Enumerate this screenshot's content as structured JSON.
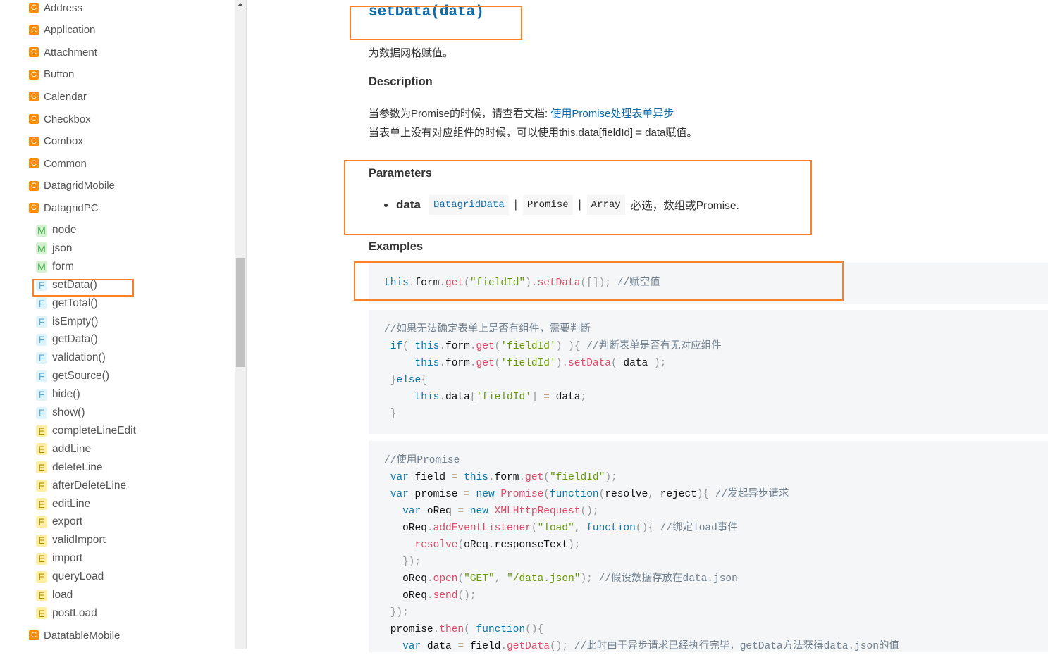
{
  "sidebar": {
    "classes": [
      {
        "icon": "C",
        "label": "Address"
      },
      {
        "icon": "C",
        "label": "Application"
      },
      {
        "icon": "C",
        "label": "Attachment"
      },
      {
        "icon": "C",
        "label": "Button"
      },
      {
        "icon": "C",
        "label": "Calendar"
      },
      {
        "icon": "C",
        "label": "Checkbox"
      },
      {
        "icon": "C",
        "label": "Combox"
      },
      {
        "icon": "C",
        "label": "Common"
      },
      {
        "icon": "C",
        "label": "DatagridMobile"
      },
      {
        "icon": "C",
        "label": "DatagridPC"
      }
    ],
    "members": [
      {
        "icon": "M",
        "label": "node"
      },
      {
        "icon": "M",
        "label": "json"
      },
      {
        "icon": "M",
        "label": "form"
      },
      {
        "icon": "F",
        "label": "setData()"
      },
      {
        "icon": "F",
        "label": "getTotal()"
      },
      {
        "icon": "F",
        "label": "isEmpty()"
      },
      {
        "icon": "F",
        "label": "getData()"
      },
      {
        "icon": "F",
        "label": "validation()"
      },
      {
        "icon": "F",
        "label": "getSource()"
      },
      {
        "icon": "F",
        "label": "hide()"
      },
      {
        "icon": "F",
        "label": "show()"
      },
      {
        "icon": "E",
        "label": "completeLineEdit"
      },
      {
        "icon": "E",
        "label": "addLine"
      },
      {
        "icon": "E",
        "label": "deleteLine"
      },
      {
        "icon": "E",
        "label": "afterDeleteLine"
      },
      {
        "icon": "E",
        "label": "editLine"
      },
      {
        "icon": "E",
        "label": "export"
      },
      {
        "icon": "E",
        "label": "validImport"
      },
      {
        "icon": "E",
        "label": "import"
      },
      {
        "icon": "E",
        "label": "queryLoad"
      },
      {
        "icon": "E",
        "label": "load"
      },
      {
        "icon": "E",
        "label": "postLoad"
      }
    ],
    "after": [
      {
        "icon": "C",
        "label": "DatatableMobile"
      }
    ]
  },
  "main": {
    "title": "setData(data)",
    "summary": "为数据网格赋值。",
    "description_heading": "Description",
    "desc1_prefix": "当参数为Promise的时候，请查看文档: ",
    "desc1_link": "使用Promise处理表单异步",
    "desc2": "当表单上没有对应组件的时候，可以使用this.data[fieldId] = data赋值。",
    "parameters_heading": "Parameters",
    "param": {
      "name": "data",
      "types": [
        "DatagridData",
        "Promise",
        "Array"
      ],
      "separator": "|",
      "desc": "必选，数组或Promise."
    },
    "examples_heading": "Examples"
  },
  "code": [
    [
      [
        [
          "k",
          "this"
        ],
        [
          "p",
          "."
        ],
        [
          "t",
          "form"
        ],
        [
          "p",
          "."
        ],
        [
          "f",
          "get"
        ],
        [
          "p",
          "("
        ],
        [
          "s",
          "\"fieldId\""
        ],
        [
          "p",
          ")"
        ],
        [
          "p",
          "."
        ],
        [
          "f",
          "setData"
        ],
        [
          "p",
          "([]);"
        ],
        [
          "t",
          " "
        ],
        [
          "c",
          "//赋空值"
        ]
      ]
    ],
    [
      [
        [
          "c",
          "//如果无法确定表单上是否有组件，需要判断"
        ]
      ],
      [
        [
          "t",
          " "
        ],
        [
          "k",
          "if"
        ],
        [
          "p",
          "("
        ],
        [
          "t",
          " "
        ],
        [
          "k",
          "this"
        ],
        [
          "p",
          "."
        ],
        [
          "t",
          "form"
        ],
        [
          "p",
          "."
        ],
        [
          "f",
          "get"
        ],
        [
          "p",
          "("
        ],
        [
          "s",
          "'fieldId'"
        ],
        [
          "p",
          ")"
        ],
        [
          "t",
          " "
        ],
        [
          "p",
          "){"
        ],
        [
          "t",
          " "
        ],
        [
          "c",
          "//判断表单是否有无对应组件"
        ]
      ],
      [
        [
          "t",
          "     "
        ],
        [
          "k",
          "this"
        ],
        [
          "p",
          "."
        ],
        [
          "t",
          "form"
        ],
        [
          "p",
          "."
        ],
        [
          "f",
          "get"
        ],
        [
          "p",
          "("
        ],
        [
          "s",
          "'fieldId'"
        ],
        [
          "p",
          ")."
        ],
        [
          "f",
          "setData"
        ],
        [
          "p",
          "("
        ],
        [
          "t",
          " data "
        ],
        [
          "p",
          ");"
        ]
      ],
      [
        [
          "t",
          " "
        ],
        [
          "p",
          "}"
        ],
        [
          "k",
          "else"
        ],
        [
          "p",
          "{"
        ]
      ],
      [
        [
          "t",
          "     "
        ],
        [
          "k",
          "this"
        ],
        [
          "p",
          "."
        ],
        [
          "t",
          "data"
        ],
        [
          "p",
          "["
        ],
        [
          "s",
          "'fieldId'"
        ],
        [
          "p",
          "]"
        ],
        [
          "t",
          " "
        ],
        [
          "o",
          "="
        ],
        [
          "t",
          " data"
        ],
        [
          "p",
          ";"
        ]
      ],
      [
        [
          "t",
          " "
        ],
        [
          "p",
          "}"
        ]
      ]
    ],
    [
      [
        [
          "c",
          "//使用Promise"
        ]
      ],
      [
        [
          "t",
          " "
        ],
        [
          "k",
          "var"
        ],
        [
          "t",
          " field "
        ],
        [
          "o",
          "="
        ],
        [
          "t",
          " "
        ],
        [
          "k",
          "this"
        ],
        [
          "p",
          "."
        ],
        [
          "t",
          "form"
        ],
        [
          "p",
          "."
        ],
        [
          "f",
          "get"
        ],
        [
          "p",
          "("
        ],
        [
          "s",
          "\"fieldId\""
        ],
        [
          "p",
          ");"
        ]
      ],
      [
        [
          "t",
          " "
        ],
        [
          "k",
          "var"
        ],
        [
          "t",
          " promise "
        ],
        [
          "o",
          "="
        ],
        [
          "t",
          " "
        ],
        [
          "k",
          "new"
        ],
        [
          "t",
          " "
        ],
        [
          "f",
          "Promise"
        ],
        [
          "p",
          "("
        ],
        [
          "k",
          "function"
        ],
        [
          "p",
          "("
        ],
        [
          "t",
          "resolve"
        ],
        [
          "p",
          ","
        ],
        [
          "t",
          " reject"
        ],
        [
          "p",
          "){"
        ],
        [
          "t",
          " "
        ],
        [
          "c",
          "//发起异步请求"
        ]
      ],
      [
        [
          "t",
          "   "
        ],
        [
          "k",
          "var"
        ],
        [
          "t",
          " oReq "
        ],
        [
          "o",
          "="
        ],
        [
          "t",
          " "
        ],
        [
          "k",
          "new"
        ],
        [
          "t",
          " "
        ],
        [
          "f",
          "XMLHttpRequest"
        ],
        [
          "p",
          "();"
        ]
      ],
      [
        [
          "t",
          "   oReq"
        ],
        [
          "p",
          "."
        ],
        [
          "f",
          "addEventListener"
        ],
        [
          "p",
          "("
        ],
        [
          "s",
          "\"load\""
        ],
        [
          "p",
          ","
        ],
        [
          "t",
          " "
        ],
        [
          "k",
          "function"
        ],
        [
          "p",
          "(){"
        ],
        [
          "t",
          " "
        ],
        [
          "c",
          "//绑定load事件"
        ]
      ],
      [
        [
          "t",
          "     "
        ],
        [
          "f",
          "resolve"
        ],
        [
          "p",
          "("
        ],
        [
          "t",
          "oReq"
        ],
        [
          "p",
          "."
        ],
        [
          "t",
          "responseText"
        ],
        [
          "p",
          ");"
        ]
      ],
      [
        [
          "t",
          "   "
        ],
        [
          "p",
          "});"
        ]
      ],
      [
        [
          "t",
          "   oReq"
        ],
        [
          "p",
          "."
        ],
        [
          "f",
          "open"
        ],
        [
          "p",
          "("
        ],
        [
          "s",
          "\"GET\""
        ],
        [
          "p",
          ","
        ],
        [
          "t",
          " "
        ],
        [
          "s",
          "\"/data.json\""
        ],
        [
          "p",
          ");"
        ],
        [
          "t",
          " "
        ],
        [
          "c",
          "//假设数据存放在data.json"
        ]
      ],
      [
        [
          "t",
          "   oReq"
        ],
        [
          "p",
          "."
        ],
        [
          "f",
          "send"
        ],
        [
          "p",
          "();"
        ]
      ],
      [
        [
          "t",
          " "
        ],
        [
          "p",
          "});"
        ]
      ],
      [
        [
          "t",
          " promise"
        ],
        [
          "p",
          "."
        ],
        [
          "f",
          "then"
        ],
        [
          "p",
          "("
        ],
        [
          "t",
          " "
        ],
        [
          "k",
          "function"
        ],
        [
          "p",
          "(){"
        ]
      ],
      [
        [
          "t",
          "   "
        ],
        [
          "k",
          "var"
        ],
        [
          "t",
          " data "
        ],
        [
          "o",
          "="
        ],
        [
          "t",
          " field"
        ],
        [
          "p",
          "."
        ],
        [
          "f",
          "getData"
        ],
        [
          "p",
          "();"
        ],
        [
          "t",
          " "
        ],
        [
          "c",
          "//此时由于异步请求已经执行完毕，getData方法获得data.json的值"
        ]
      ]
    ]
  ],
  "colors": {
    "highlight": "#ff7f27",
    "class_icon": "#ff8c00",
    "link": "#0e6aa8"
  }
}
